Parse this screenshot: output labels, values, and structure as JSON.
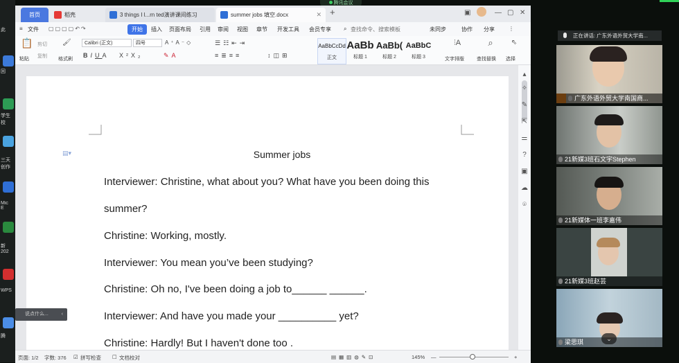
{
  "meeting": {
    "app_label": "腾讯会议",
    "speaking_label": "正在讲话: 广东外语外贸大学南...",
    "participants": [
      {
        "name": "广东外语外贸大学南国商..."
      },
      {
        "name": "21新媒3班石文宇Stephen"
      },
      {
        "name": "21新媒体一班李嘉伟"
      },
      {
        "name": "21新媒3班赵芸"
      },
      {
        "name": "梁思琪"
      }
    ],
    "expand_icon": "chevron-down-icon"
  },
  "desktop": {
    "labels": [
      "此",
      "回",
      "学生\n校",
      "三天\n创作",
      "Mic\nE",
      "新\n202",
      "WPS",
      "腾"
    ]
  },
  "tabs": [
    {
      "label": "首页"
    },
    {
      "label": "稻壳"
    },
    {
      "label": "3 things I l...rn ted演讲课间练习"
    },
    {
      "label": "summer jobs 填空.docx"
    }
  ],
  "menu": {
    "items": [
      "文件",
      "开始",
      "插入",
      "页面布局",
      "引用",
      "审阅",
      "视图",
      "章节",
      "开发工具",
      "会员专享"
    ],
    "search_placeholder": "查找命令、搜索模板",
    "right": [
      "未同步",
      "协作",
      "分享"
    ]
  },
  "ribbon": {
    "paste": "粘贴",
    "cut": "剪切",
    "copy": "复制",
    "format_painter": "格式刷",
    "font_name": "Calibri (正文)",
    "font_size": "四号",
    "styles": [
      {
        "preview": "AaBbCcDd",
        "name": "正文"
      },
      {
        "preview": "AaBb",
        "name": "标题 1"
      },
      {
        "preview": "AaBb(",
        "name": "标题 2"
      },
      {
        "preview": "AaBbC",
        "name": "标题 3"
      }
    ],
    "text_layout": "文字排版",
    "find_replace": "查找替换",
    "select": "选择"
  },
  "document": {
    "title": "Summer jobs",
    "lines": [
      "Interviewer: Christine, what about you? What have you been doing this",
      "summer?",
      "Christine: Working, mostly.",
      "Interviewer: You mean you’ve been studying?",
      "Christine: Oh no, I've been doing a job to______  ______.",
      "Interviewer: And have you made your  __________  yet?",
      "Christine: Hardly! But I haven't done too                 ."
    ]
  },
  "status": {
    "page": "页面: 1/2",
    "words": "字数: 376",
    "spell": "拼写检查",
    "doc_check": "文档校对",
    "zoom": "145%"
  },
  "popup": {
    "label": "说点什么..."
  }
}
